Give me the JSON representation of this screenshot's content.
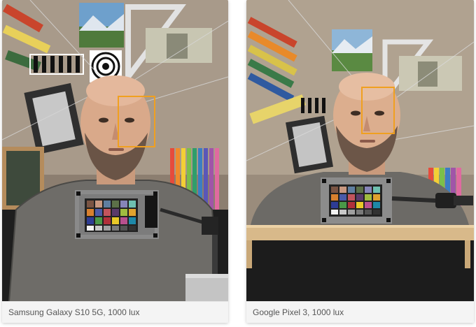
{
  "cards": [
    {
      "caption": "Samsung Galaxy S10 5G, 1000 lux"
    },
    {
      "caption": "Google Pixel 3, 1000 lux"
    }
  ]
}
